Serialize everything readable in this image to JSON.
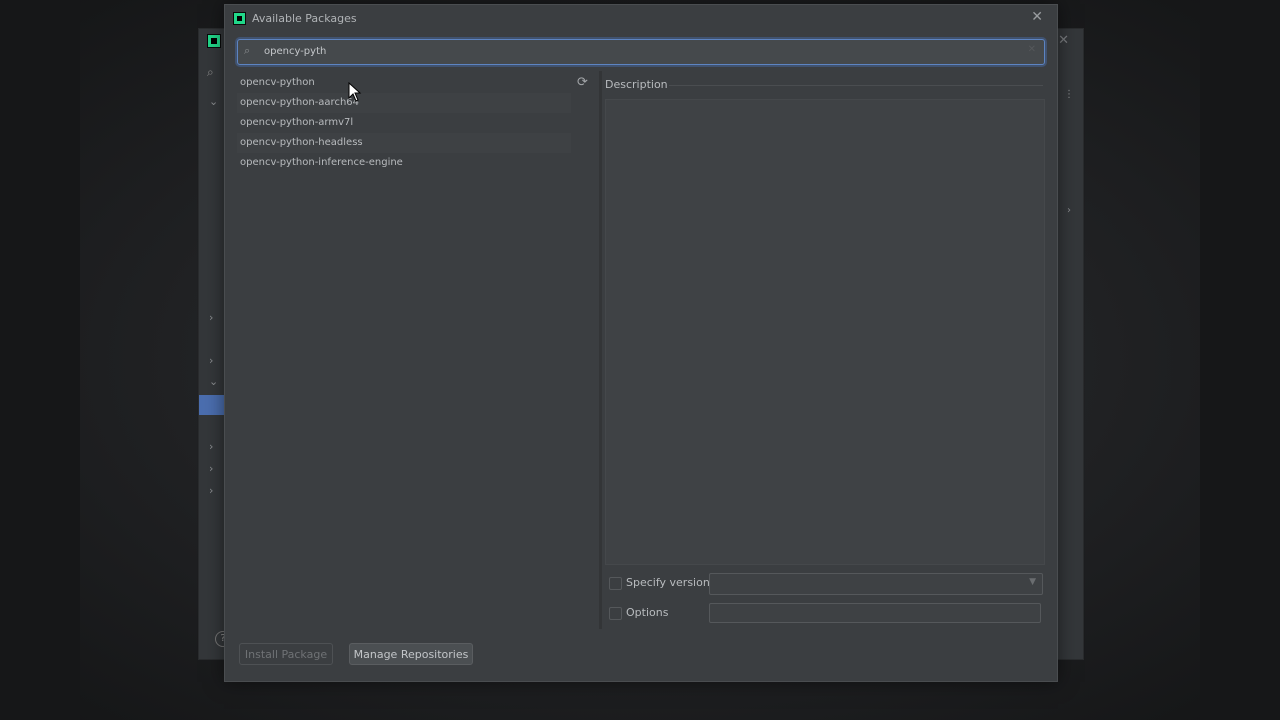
{
  "dialog": {
    "title": "Available Packages",
    "close_icon": "close-icon",
    "search": {
      "value": "opency-pyth",
      "placeholder": ""
    },
    "packages": [
      "opencv-python",
      "opencv-python-aarch64",
      "opencv-python-armv7l",
      "opencv-python-headless",
      "opencv-python-inference-engine"
    ],
    "description_label": "Description",
    "specify_version_label": "Specify version",
    "options_label": "Options",
    "install_button": "Install Package",
    "manage_button": "Manage Repositories"
  },
  "background_window": {
    "help_label": "?"
  },
  "colors": {
    "accent": "#4b6eaf",
    "focus_border": "#5d84c1",
    "app_logo": "#21d789"
  }
}
